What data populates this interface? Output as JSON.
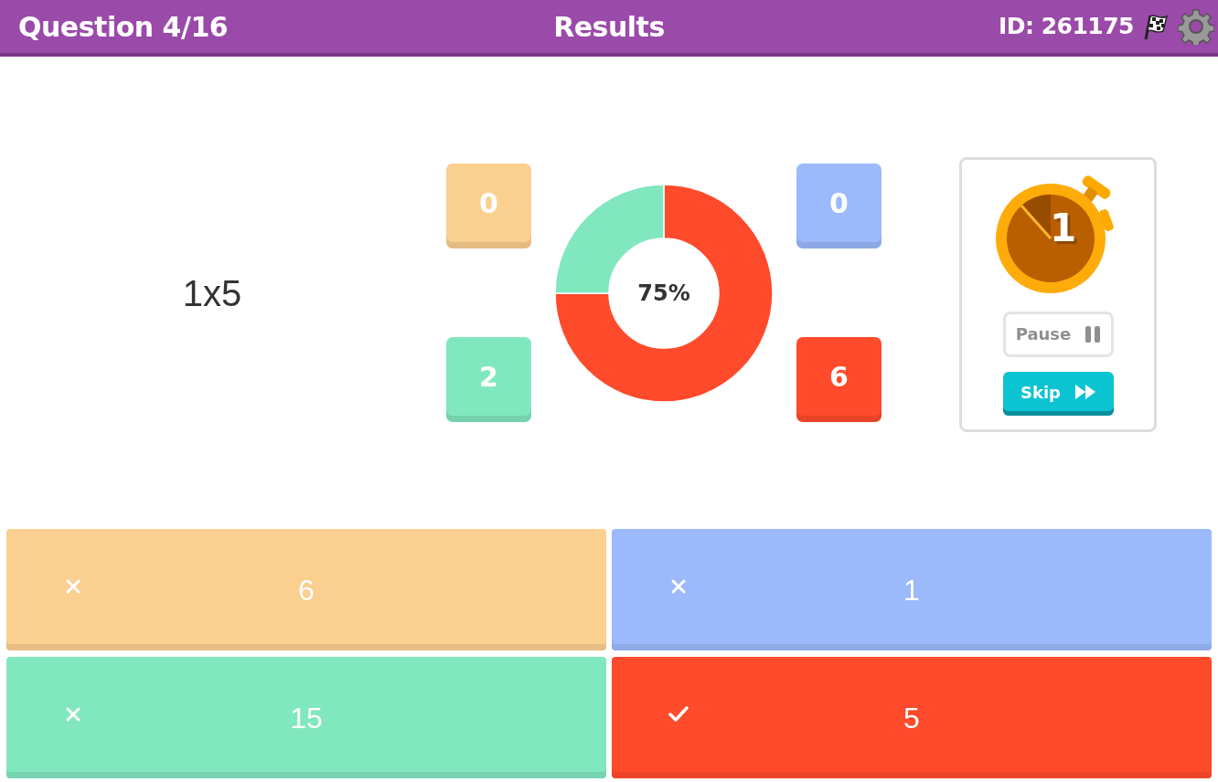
{
  "header": {
    "question": "Question 4/16",
    "title": "Results",
    "id_label": "ID: 261175"
  },
  "question_text": "1x5",
  "results": {
    "tiles": [
      {
        "count": "0",
        "color": "#fbcf8f"
      },
      {
        "count": "0",
        "color": "#9bb9fb"
      },
      {
        "count": "2",
        "color": "#81e7bf"
      },
      {
        "count": "6",
        "color": "#ff4a2b"
      }
    ],
    "percent_label": "75%",
    "chart_data": {
      "type": "donut",
      "values": [
        0,
        0,
        25,
        75
      ]
    }
  },
  "timer": {
    "value": "1",
    "pause_label": "Pause",
    "skip_label": "Skip"
  },
  "answers": [
    {
      "text": "6",
      "correct": false,
      "color": "#fbcf8f"
    },
    {
      "text": "1",
      "correct": false,
      "color": "#9bb9fb"
    },
    {
      "text": "15",
      "correct": false,
      "color": "#81e7bf"
    },
    {
      "text": "5",
      "correct": true,
      "color": "#ff4a2b"
    }
  ]
}
